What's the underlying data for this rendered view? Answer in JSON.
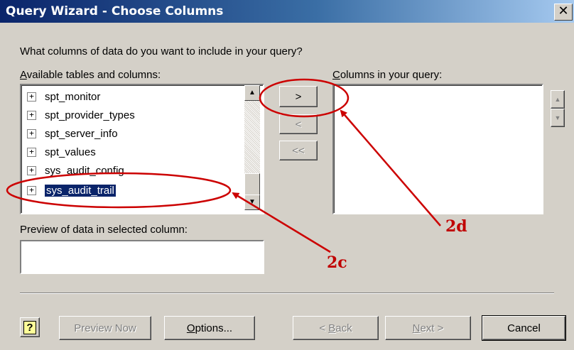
{
  "window": {
    "title": "Query Wizard - Choose Columns",
    "close_glyph": "✕"
  },
  "prompt": "What columns of data do you want to include in your query?",
  "available": {
    "label_rest": "vailable tables and columns:",
    "label_first": "A",
    "items": [
      "spt_monitor",
      "spt_provider_types",
      "spt_server_info",
      "spt_values",
      "sys_audit_config",
      "sys_audit_trail"
    ],
    "selected_item": "sys_audit_trail"
  },
  "query_columns": {
    "label_first": "C",
    "label_rest": "olumns in your query:",
    "items": []
  },
  "move_buttons": {
    "add": ">",
    "remove": "<",
    "remove_all": "<<"
  },
  "preview": {
    "label": "Preview of data in selected column:",
    "value": ""
  },
  "footer": {
    "help_glyph": "?",
    "preview_now": "Preview Now",
    "options_first": "O",
    "options_rest": "ptions...",
    "back_prefix": "< ",
    "back_first": "B",
    "back_rest": "ack",
    "next_first": "N",
    "next_rest": "ext >",
    "cancel": "Cancel"
  },
  "annotations": {
    "label_2c": "2c",
    "label_2d": "2d",
    "color": "#cc0000"
  },
  "icons": {
    "expander": "plus-box-icon",
    "scroll_up": "arrow-up-icon",
    "scroll_down": "arrow-down-icon"
  }
}
